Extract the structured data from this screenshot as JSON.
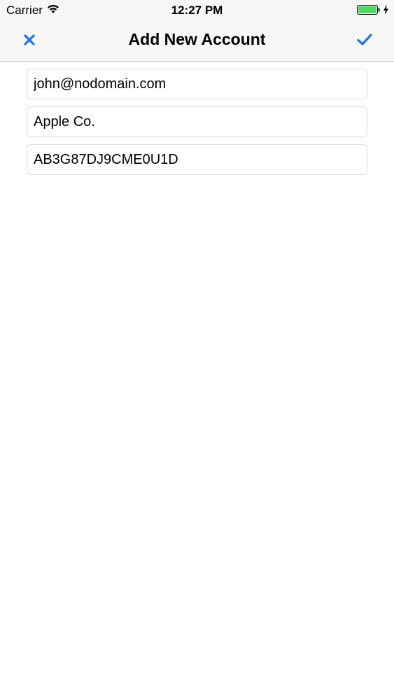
{
  "status_bar": {
    "carrier": "Carrier",
    "time": "12:27 PM",
    "battery_color": "#4cd964"
  },
  "nav": {
    "title": "Add New Account",
    "close_icon": "close-icon",
    "done_icon": "checkmark-icon",
    "accent_color": "#1a73e8"
  },
  "form": {
    "email_value": "john@nodomain.com",
    "company_value": "Apple Co.",
    "key_value": "AB3G87DJ9CME0U1D"
  }
}
